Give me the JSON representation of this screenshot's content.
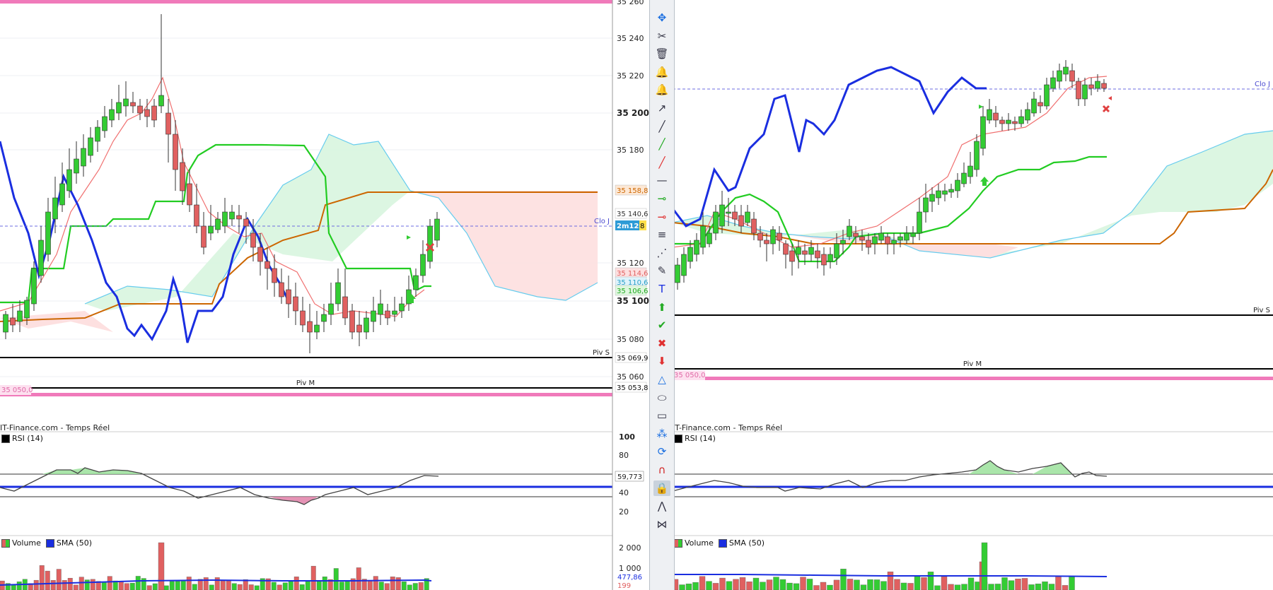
{
  "left": {
    "header": "IT-Finance.com - Temps Réel",
    "rsi_label": "RSI (14)",
    "vol_label": "Volume",
    "sma_label": "SMA (50)",
    "price_ticks": [
      "35 260",
      "35 240",
      "35 220",
      "35 200",
      "35 180",
      "35 120",
      "35 100",
      "35 080",
      "35 060"
    ],
    "clo_label": "Clo J",
    "piv_s_label": "Piv S",
    "piv_m_label": "Piv M",
    "badges": {
      "b1": "35 158,8",
      "b2": "35 140,6",
      "b3": "2m12s",
      "b3b": "8",
      "b4": "35 114,6",
      "b5": "35 110,6",
      "b6": "35 106,6",
      "b7": "35 069,9",
      "b8": "35 053,8",
      "b9": "35 050,0"
    },
    "rsi_ticks": [
      "100",
      "80",
      "40",
      "20"
    ],
    "rsi_value": "59,773",
    "vol_ticks": [
      "2 000",
      "1 000"
    ],
    "vol_badges": {
      "a": "477,86",
      "b": "199"
    }
  },
  "right": {
    "header": "IT-Finance.com - Temps Réel",
    "rsi_label": "RSI (14)",
    "vol_label": "Volume",
    "sma_label": "SMA (50)",
    "clo_label": "Clo J",
    "piv_s_label": "Piv S",
    "piv_m_label": "Piv M",
    "badge": "35 050,0"
  },
  "colors": {
    "up": "#33cc33",
    "down": "#e06060",
    "tenkan": "#f07070",
    "kijun": "#22cc22",
    "chikou": "#1a2ee0",
    "senkou_b": "#cc6600",
    "kumo_up": "#d8f5df",
    "kumo_down": "#fde0e0",
    "kumo_edge": "#66ccee",
    "pivot": "#000000",
    "pink": "#f07aba",
    "sma": "#1a2ee0"
  },
  "toolbar": [
    "move-tool",
    "scissors-tool",
    "trash-tool",
    "alert-tool",
    "alert2-tool",
    "arrow-line-tool",
    "line-tool",
    "green-line-tool",
    "red-line-tool",
    "hline-tool",
    "green-ray-tool",
    "red-ray-tool",
    "fibo-tool",
    "fan-tool",
    "pen-tool",
    "text-tool",
    "up-arrow-tool",
    "check-tool",
    "cross-tool",
    "down-arrow-tool",
    "triangle-tool",
    "ellipse-tool",
    "rect-tool",
    "points-tool",
    "rotate-tool",
    "magnet-tool",
    "lock-tool",
    "zigzag-tool",
    "pattern-tool"
  ]
}
